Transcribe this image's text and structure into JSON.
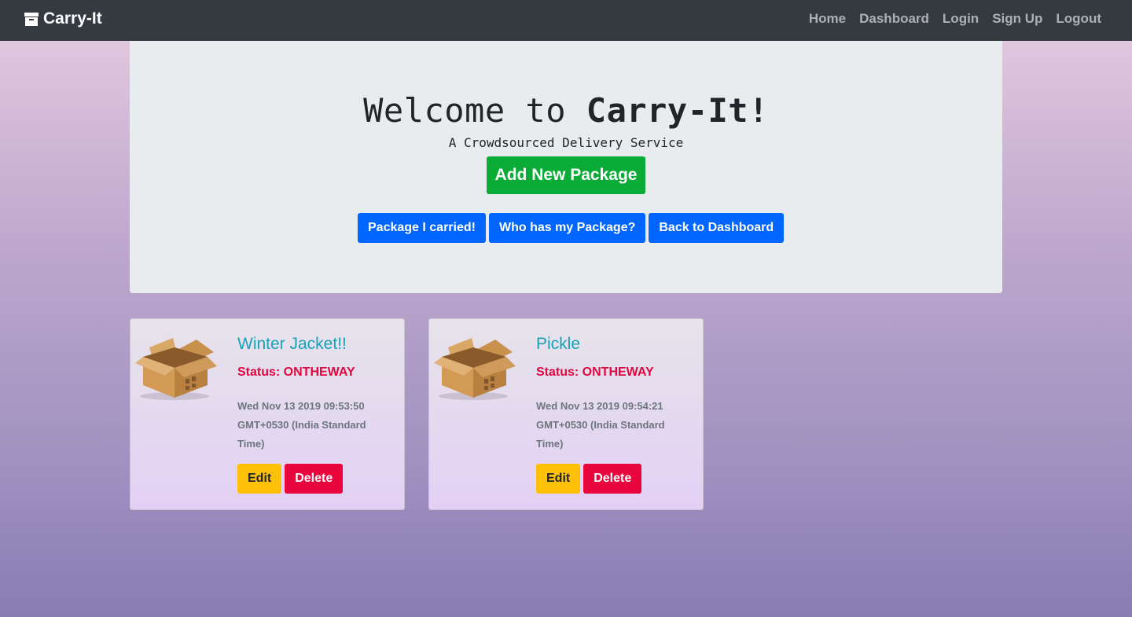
{
  "navbar": {
    "brand": "Carry-It",
    "links": [
      "Home",
      "Dashboard",
      "Login",
      "Sign Up",
      "Logout"
    ]
  },
  "hero": {
    "welcome_prefix": "Welcome to ",
    "welcome_brand": "Carry-It!",
    "tagline": "A Crowdsourced Delivery Service",
    "add_button": "Add New Package",
    "buttons": [
      "Package I carried!",
      "Who has my Package?",
      "Back to Dashboard"
    ]
  },
  "packages": [
    {
      "title": "Winter Jacket!!",
      "status": "Status: ONTHEWAY",
      "date": "Wed Nov 13 2019 09:53:50 GMT+0530 (India Standard Time)",
      "edit": "Edit",
      "delete": "Delete"
    },
    {
      "title": "Pickle",
      "status": "Status: ONTHEWAY",
      "date": "Wed Nov 13 2019 09:54:21 GMT+0530 (India Standard Time)",
      "edit": "Edit",
      "delete": "Delete"
    }
  ],
  "colors": {
    "navbar": "#343a40",
    "jumbotron": "#e9ecef",
    "add_button": "#0aab37",
    "primary": "#0066ff",
    "title": "#17a2b8",
    "status": "#e0083f",
    "edit": "#ffc107",
    "delete": "#e8063c"
  },
  "icons": {
    "brand": "archive-icon",
    "package": "open-cardboard-box-icon"
  }
}
